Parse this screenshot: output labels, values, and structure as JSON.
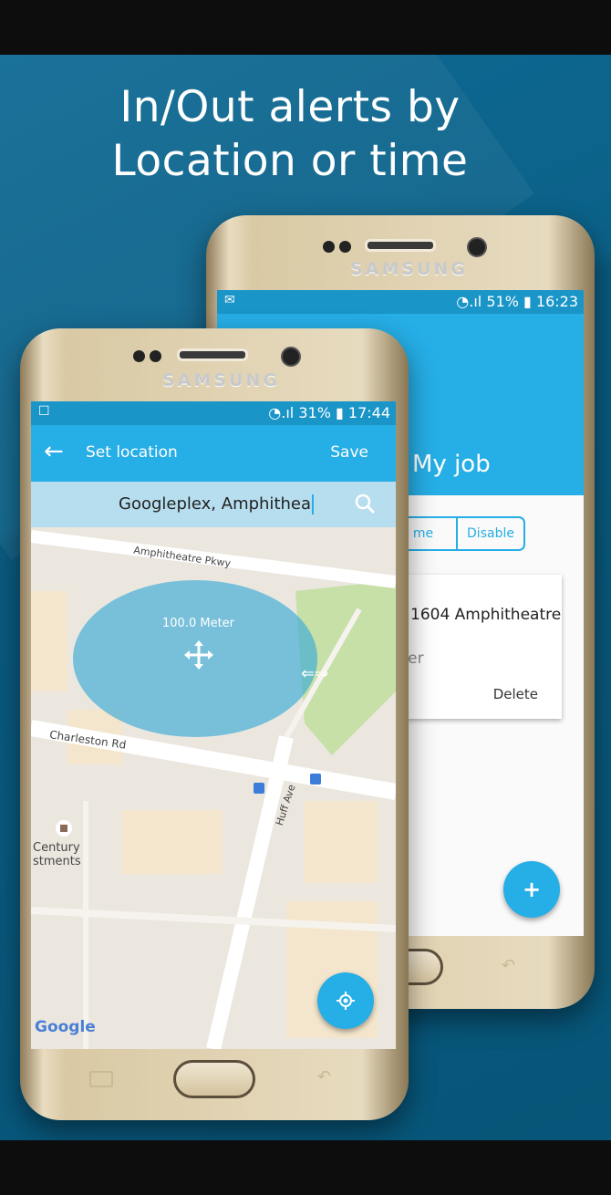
{
  "headline": {
    "line1": "In/Out alerts by",
    "line2": "Location or time"
  },
  "back_phone": {
    "brand": "SAMSUNG",
    "status": {
      "signal": "⊙.ıl",
      "battery": "51%",
      "time": "16:23",
      "notification": "✉"
    },
    "app_title": "My job",
    "toggle": {
      "left": "me",
      "right": "Disable"
    },
    "card": {
      "address": "1604 Amphitheatre",
      "sub": "eter",
      "delete_label": "Delete"
    },
    "fab_label": "+"
  },
  "front_phone": {
    "brand": "SAMSUNG",
    "status": {
      "battery": "31%",
      "time": "17:44"
    },
    "appbar": {
      "back_label": "←",
      "title": "Set location",
      "save_label": "Save"
    },
    "search": {
      "value": "Googleplex, Amphithea"
    },
    "map": {
      "radius_label": "100.0 Meter",
      "resize_label": "⇐⇒",
      "road_amphitheatre": "Amphitheatre Pkwy",
      "road_charleston": "Charleston Rd",
      "road_huff": "Huff Ave",
      "poi_line1": "Century",
      "poi_line2": "stments",
      "attribution": "Google"
    }
  },
  "colors": {
    "accent": "#26aee6",
    "banner": "#0b6188"
  }
}
